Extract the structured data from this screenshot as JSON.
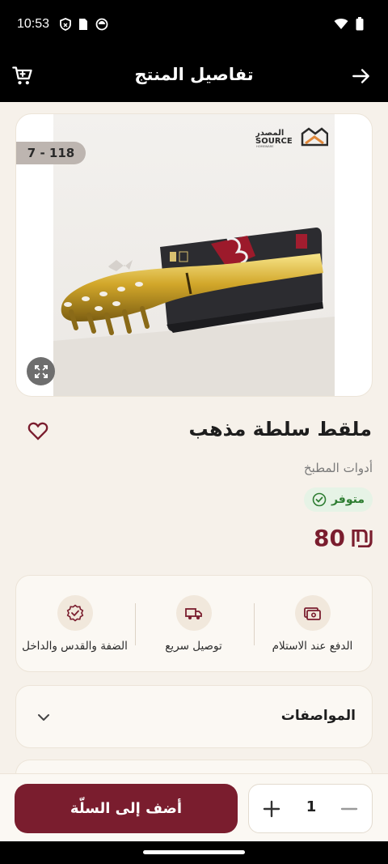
{
  "status_bar": {
    "time": "10:53"
  },
  "header": {
    "title": "تفاصيل المنتج"
  },
  "product": {
    "code": "7 - 118",
    "brand_logo": {
      "arabic": "المصدر",
      "latin": "SOURCE",
      "tagline": "HOMEWARE"
    },
    "title": "ملقط سلطة مذهب",
    "category": "أدوات المطبخ",
    "stock": "متوفر",
    "price": "80",
    "currency_icon": "shekel-icon"
  },
  "features": [
    {
      "label": "الدفع عند الاستلام",
      "icon": "cash-icon"
    },
    {
      "label": "توصيل سريع",
      "icon": "truck-icon"
    },
    {
      "label": "الضفة والقدس والداخل",
      "icon": "verified-badge-icon"
    }
  ],
  "specs": {
    "title": "المواصفات"
  },
  "cart": {
    "add_label": "أضف إلى السلّة",
    "quantity": "1"
  },
  "colors": {
    "primary": "#7a1d2e",
    "background": "#f6f1ea",
    "in_stock": "#2e7d32"
  }
}
